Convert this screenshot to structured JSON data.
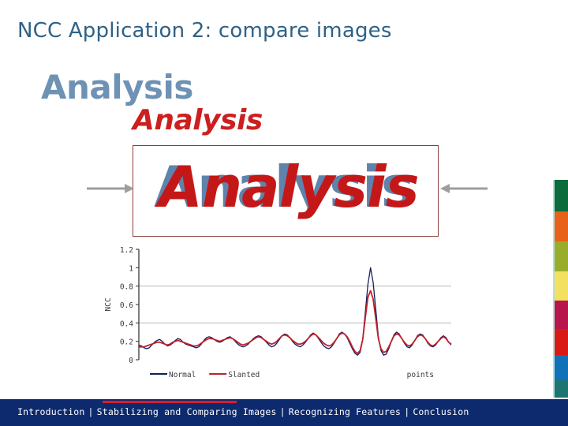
{
  "slide": {
    "title": "NCC Application 2: compare images"
  },
  "samples": {
    "normal_word": "Analysis",
    "slanted_word": "Analysis",
    "overlay_word_back": "Analysis",
    "overlay_word_front": "Analysis",
    "arrow_left_name": "arrow-right-into-box",
    "arrow_right_name": "arrow-left-into-box"
  },
  "colors": {
    "title": "#2f6186",
    "normal_word": "#6e92b4",
    "slanted_word": "#cc1f1f",
    "overlay_frame_border": "#8d3a3a",
    "footer_bg": "#0e2a6e",
    "footer_underline": "#d81e2c",
    "series_normal": "#12205c",
    "series_slanted": "#c0202a",
    "gridline": "#b9b9b9"
  },
  "color_strip": {
    "bands": [
      {
        "name": "green",
        "hex": "#0b6b3a",
        "height": 40
      },
      {
        "name": "orange",
        "hex": "#e8621a",
        "height": 38
      },
      {
        "name": "yellow-green",
        "hex": "#9aad2a",
        "height": 38
      },
      {
        "name": "yellow",
        "hex": "#f2e05e",
        "height": 37
      },
      {
        "name": "crimson",
        "hex": "#b8154c",
        "height": 36
      },
      {
        "name": "red",
        "hex": "#d91a14",
        "height": 33
      },
      {
        "name": "blue",
        "hex": "#1071b8",
        "height": 32
      },
      {
        "name": "teal",
        "hex": "#1d7470",
        "height": 28
      }
    ]
  },
  "footer": {
    "items": [
      "Introduction",
      "Stabilizing and Comparing Images",
      "Recognizing Features",
      "Conclusion"
    ],
    "separator": "|",
    "active_index": 1
  },
  "chart_data": {
    "type": "line",
    "title": "",
    "xlabel": "points",
    "ylabel": "NCC",
    "ylim": [
      0,
      1.2
    ],
    "yticks": [
      0,
      0.2,
      0.4,
      0.6,
      0.8,
      1,
      1.2
    ],
    "ytick_labels": [
      "0",
      "0.2",
      "0.4",
      "0.6",
      "0.8",
      "1",
      "1.2"
    ],
    "gridlines": [
      0.4,
      0.8
    ],
    "grid": true,
    "legend_position": "bottom-left",
    "xlim": [
      0,
      120
    ],
    "x": [
      0,
      1,
      2,
      3,
      4,
      5,
      6,
      7,
      8,
      9,
      10,
      11,
      12,
      13,
      14,
      15,
      16,
      17,
      18,
      19,
      20,
      21,
      22,
      23,
      24,
      25,
      26,
      27,
      28,
      29,
      30,
      31,
      32,
      33,
      34,
      35,
      36,
      37,
      38,
      39,
      40,
      41,
      42,
      43,
      44,
      45,
      46,
      47,
      48,
      49,
      50,
      51,
      52,
      53,
      54,
      55,
      56,
      57,
      58,
      59,
      60,
      61,
      62,
      63,
      64,
      65,
      66,
      67,
      68,
      69,
      70,
      71,
      72,
      73,
      74,
      75,
      76,
      77,
      78,
      79,
      80,
      81,
      82,
      83,
      84,
      85,
      86,
      87,
      88,
      89,
      90,
      91,
      92,
      93,
      94,
      95,
      96,
      97,
      98,
      99,
      100,
      101,
      102,
      103,
      104,
      105,
      106,
      107,
      108,
      109,
      110,
      111,
      112,
      113,
      114,
      115,
      116,
      117,
      118,
      119,
      120
    ],
    "series": [
      {
        "name": "Normal",
        "color": "#12205c",
        "values": [
          0.16,
          0.15,
          0.13,
          0.12,
          0.13,
          0.16,
          0.19,
          0.21,
          0.22,
          0.2,
          0.17,
          0.15,
          0.16,
          0.18,
          0.21,
          0.23,
          0.22,
          0.19,
          0.17,
          0.16,
          0.15,
          0.14,
          0.13,
          0.14,
          0.17,
          0.21,
          0.24,
          0.25,
          0.24,
          0.22,
          0.2,
          0.19,
          0.2,
          0.22,
          0.24,
          0.25,
          0.23,
          0.2,
          0.17,
          0.15,
          0.14,
          0.15,
          0.17,
          0.2,
          0.23,
          0.25,
          0.26,
          0.25,
          0.22,
          0.19,
          0.16,
          0.14,
          0.15,
          0.18,
          0.22,
          0.26,
          0.28,
          0.27,
          0.24,
          0.2,
          0.17,
          0.15,
          0.14,
          0.16,
          0.19,
          0.23,
          0.27,
          0.29,
          0.27,
          0.23,
          0.19,
          0.15,
          0.13,
          0.12,
          0.14,
          0.18,
          0.23,
          0.28,
          0.3,
          0.28,
          0.24,
          0.18,
          0.12,
          0.07,
          0.05,
          0.08,
          0.22,
          0.52,
          0.82,
          1.0,
          0.84,
          0.55,
          0.25,
          0.1,
          0.05,
          0.06,
          0.12,
          0.2,
          0.27,
          0.3,
          0.28,
          0.23,
          0.18,
          0.14,
          0.13,
          0.16,
          0.21,
          0.26,
          0.28,
          0.27,
          0.23,
          0.18,
          0.15,
          0.14,
          0.16,
          0.2,
          0.24,
          0.26,
          0.24,
          0.19,
          0.16
        ]
      },
      {
        "name": "Slanted",
        "color": "#c0202a",
        "values": [
          0.14,
          0.14,
          0.14,
          0.15,
          0.16,
          0.17,
          0.18,
          0.19,
          0.19,
          0.18,
          0.17,
          0.16,
          0.17,
          0.19,
          0.2,
          0.21,
          0.2,
          0.19,
          0.18,
          0.17,
          0.16,
          0.15,
          0.15,
          0.16,
          0.18,
          0.2,
          0.22,
          0.23,
          0.23,
          0.22,
          0.21,
          0.2,
          0.21,
          0.22,
          0.23,
          0.24,
          0.23,
          0.21,
          0.19,
          0.17,
          0.16,
          0.17,
          0.18,
          0.2,
          0.22,
          0.24,
          0.25,
          0.24,
          0.22,
          0.2,
          0.18,
          0.17,
          0.18,
          0.2,
          0.23,
          0.26,
          0.27,
          0.26,
          0.24,
          0.21,
          0.19,
          0.17,
          0.17,
          0.18,
          0.2,
          0.23,
          0.26,
          0.28,
          0.27,
          0.24,
          0.21,
          0.18,
          0.16,
          0.15,
          0.16,
          0.19,
          0.23,
          0.27,
          0.29,
          0.28,
          0.25,
          0.2,
          0.14,
          0.09,
          0.07,
          0.1,
          0.22,
          0.46,
          0.68,
          0.75,
          0.66,
          0.45,
          0.23,
          0.12,
          0.08,
          0.09,
          0.14,
          0.2,
          0.26,
          0.28,
          0.27,
          0.23,
          0.19,
          0.16,
          0.15,
          0.17,
          0.21,
          0.25,
          0.27,
          0.26,
          0.23,
          0.19,
          0.16,
          0.15,
          0.17,
          0.2,
          0.23,
          0.25,
          0.23,
          0.19,
          0.17
        ]
      }
    ]
  }
}
